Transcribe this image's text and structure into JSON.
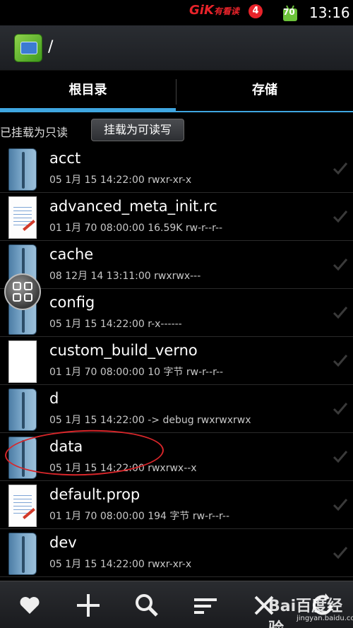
{
  "status_bar": {
    "brand_text": "GiK",
    "brand_suffix": "有看读",
    "brand_badge": "4",
    "battery_level": "70",
    "time": "13:16"
  },
  "header": {
    "path": "/"
  },
  "tabs": [
    {
      "label": "根目录",
      "active": true
    },
    {
      "label": "存储",
      "active": false
    }
  ],
  "mount": {
    "status": "已挂载为只读",
    "button_label": "挂载为可读写"
  },
  "files": [
    {
      "name": "acct",
      "meta": "05 1月 15 14:22:00   rwxr-xr-x",
      "icon": "folder-icon"
    },
    {
      "name": "advanced_meta_init.rc",
      "meta": "01 1月 70 08:00:00  16.59K  rw-r--r--",
      "icon": "document-icon"
    },
    {
      "name": "cache",
      "meta": "08 12月 14 13:11:00   rwxrwx---",
      "icon": "folder-icon"
    },
    {
      "name": "config",
      "meta": "05 1月 15 14:22:00   r-x------",
      "icon": "folder-icon"
    },
    {
      "name": "custom_build_verno",
      "meta": "01 1月 70 08:00:00  10 字节  rw-r--r--",
      "icon": "file-icon"
    },
    {
      "name": "d",
      "meta": "05 1月 15 14:22:00  -> debug  rwxrwxrwx",
      "icon": "folder-icon"
    },
    {
      "name": "data",
      "meta": "05 1月 15 14:22:00   rwxrwx--x",
      "icon": "folder-icon"
    },
    {
      "name": "default.prop",
      "meta": "01 1月 70 08:00:00  194 字节  rw-r--r--",
      "icon": "document-icon"
    },
    {
      "name": "dev",
      "meta": "05 1月 15 14:22:00   rwxr-xr-x",
      "icon": "folder-icon"
    }
  ],
  "bottom_bar": {
    "icons": [
      "favorite-icon",
      "add-icon",
      "search-icon",
      "sort-icon",
      "close-icon",
      "refresh-icon"
    ]
  },
  "watermark": {
    "text": "Bai百度经验",
    "url": "jingyan.baidu.com"
  },
  "colors": {
    "accent": "#3fa6e0",
    "annotation": "#d8262a"
  }
}
